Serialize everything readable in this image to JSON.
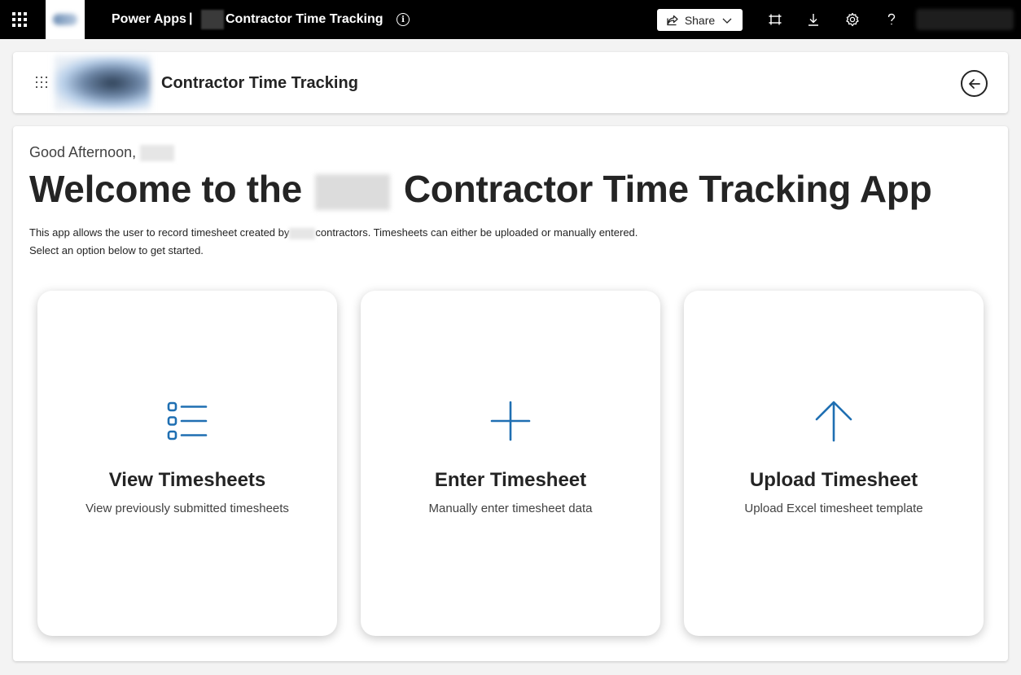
{
  "topbar": {
    "app_name": "Power Apps",
    "separator": "|",
    "app_title": "Contractor Time Tracking",
    "info_glyph": "i",
    "share_label": "Share",
    "icons": [
      "waffle-icon",
      "info-icon",
      "share-icon",
      "chevron-down-icon",
      "fit-to-screen-icon",
      "download-icon",
      "gear-icon",
      "help-icon"
    ]
  },
  "header": {
    "title": "Contractor Time Tracking"
  },
  "main": {
    "greeting": "Good Afternoon,",
    "welcome_prefix": "Welcome to the",
    "welcome_suffix": "Contractor Time Tracking App",
    "desc_line1_a": "This app allows the user to record timesheet created by",
    "desc_line1_b": "contractors. Timesheets can either be uploaded or manually entered.",
    "desc_line2": "Select an option below to get started.",
    "options": [
      {
        "title": "View Timesheets",
        "subtitle": "View previously submitted timesheets",
        "icon": "list-icon"
      },
      {
        "title": "Enter Timesheet",
        "subtitle": "Manually enter timesheet data",
        "icon": "plus-icon"
      },
      {
        "title": "Upload Timesheet",
        "subtitle": "Upload Excel timesheet template",
        "icon": "arrow-up-icon"
      }
    ]
  },
  "colors": {
    "topbar_bg": "#000000",
    "accent_blue": "#1f6fb2",
    "text": "#242424",
    "page_bg": "#f3f3f3"
  }
}
